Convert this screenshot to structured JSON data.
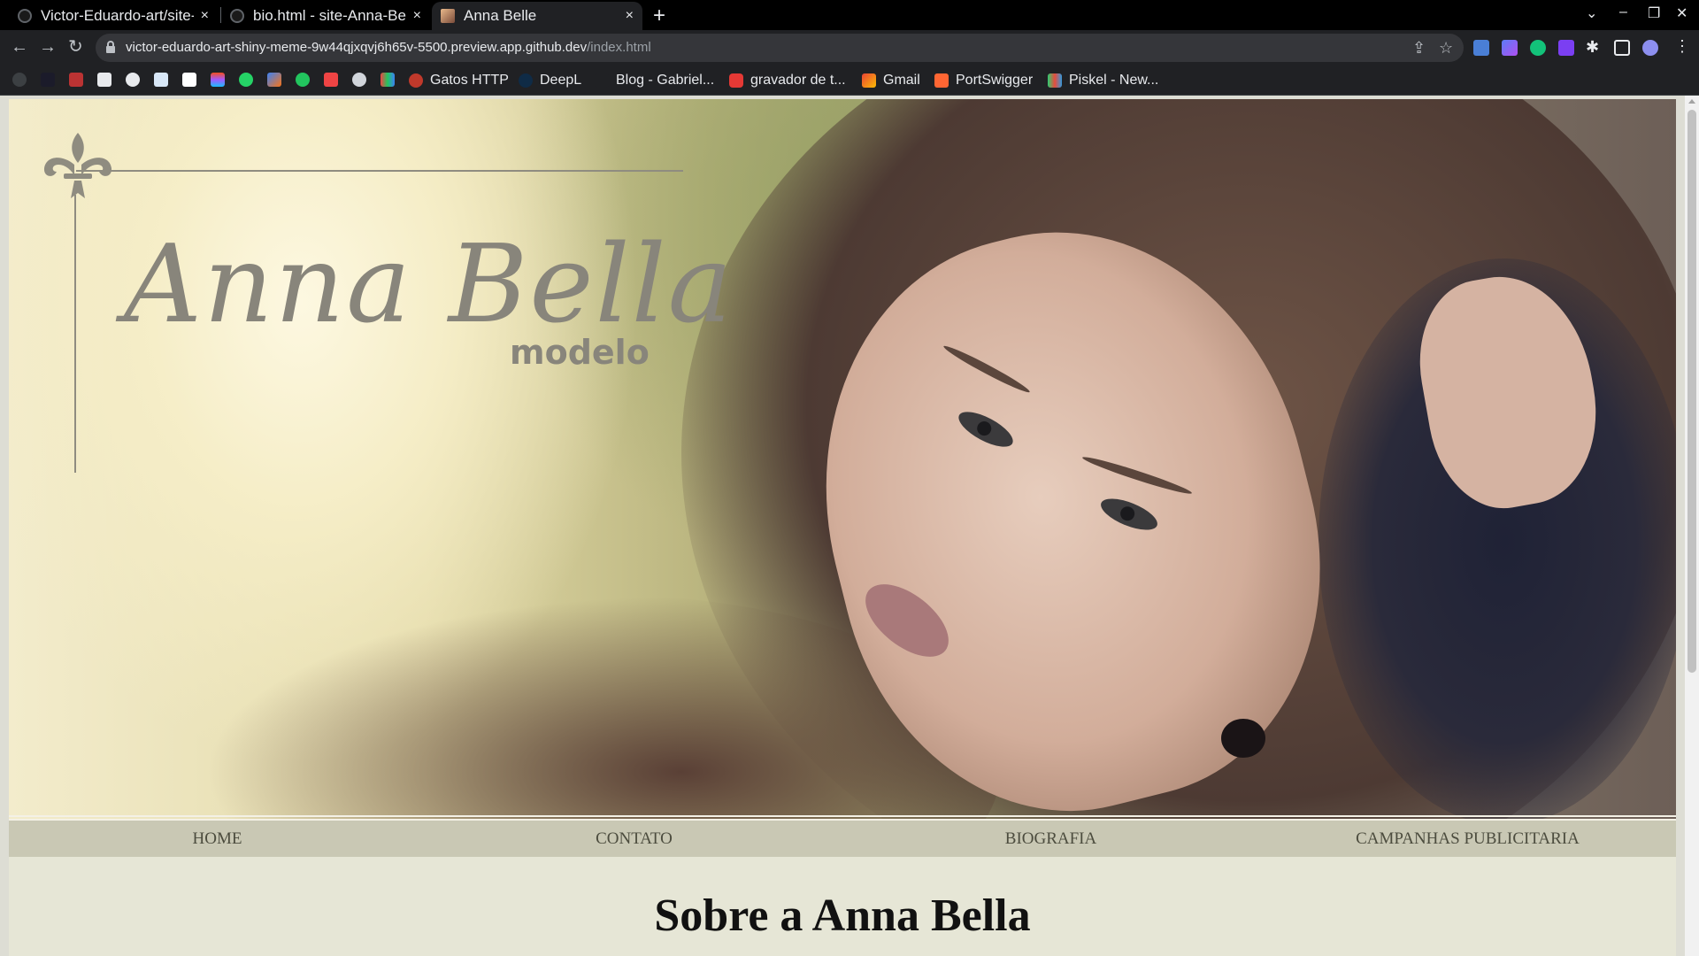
{
  "browser": {
    "tabs": [
      {
        "title": "Victor-Eduardo-art/site-Anna-Bella",
        "icon": "github-icon"
      },
      {
        "title": "bio.html - site-Anna-Bella",
        "icon": "github-icon"
      },
      {
        "title": "Anna Belle",
        "icon": "site-favicon"
      }
    ],
    "new_tab": "+",
    "close_glyph": "×",
    "url_host": "victor-eduardo-art-shiny-meme-9w44qjxqvj6h65v-5500.preview.app.github.dev",
    "url_path": "/index.html",
    "bookmarks": [
      "Gatos HTTP",
      "DeepL",
      "Blog - Gabriel...",
      "gravador de t...",
      "Gmail",
      "PortSwigger",
      "Piskel - New..."
    ]
  },
  "site": {
    "logo_name": "Anna Bella",
    "logo_sub": "modelo",
    "menu": [
      "HOME",
      "CONTATO",
      "BIOGRAFIA",
      "CAMPANHAS PUBLICITARIA"
    ],
    "heading": "Sobre a Anna Bella"
  },
  "colors": {
    "menu_bg": "#c9c8b4",
    "page_bg": "#e6e6d6",
    "logo_gray": "#88857b"
  }
}
